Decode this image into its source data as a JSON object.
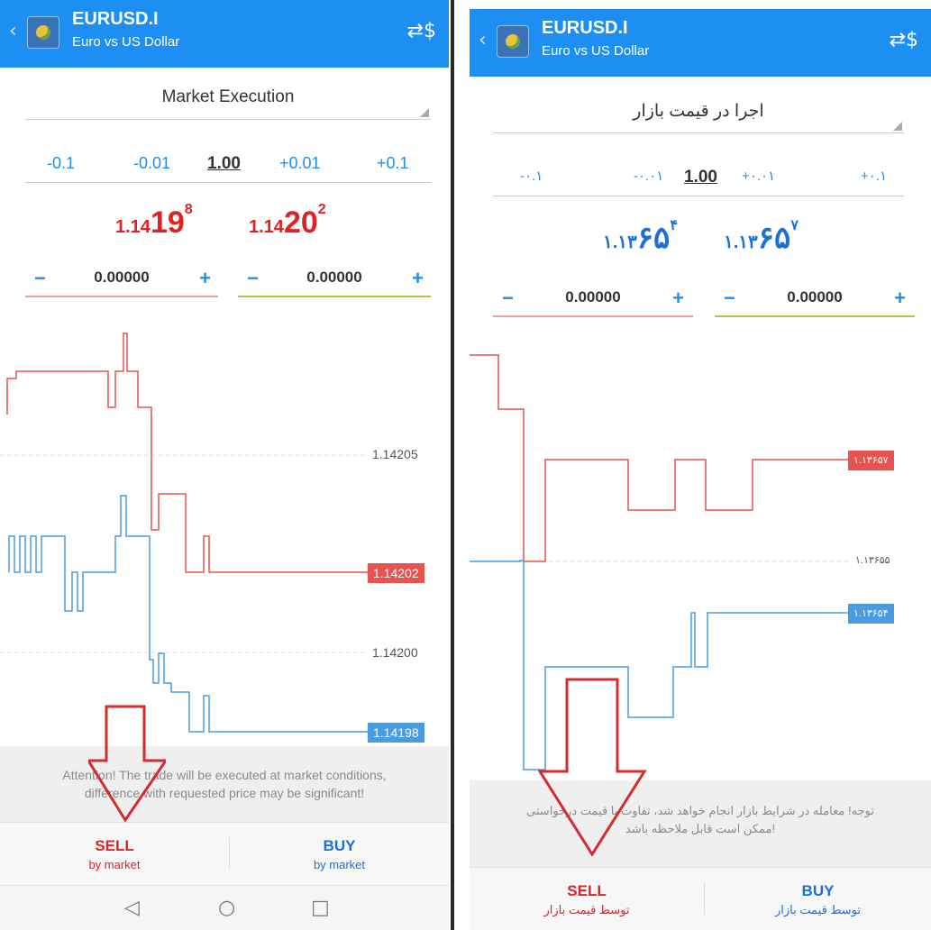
{
  "left": {
    "symbol": "EURUSD.I",
    "description": "Euro vs US Dollar",
    "back_icon": "chevron-left-icon",
    "swap_icon": "currency-exchange-icon",
    "execution_type": "Market Execution",
    "volume": {
      "minus_01": "-0.1",
      "minus_001": "-0.01",
      "value": "1.00",
      "plus_001": "+0.01",
      "plus_01": "+0.1"
    },
    "sell_price": {
      "prefix": "1.14",
      "big": "19",
      "sup": "8"
    },
    "buy_price": {
      "prefix": "1.14",
      "big": "20",
      "sup": "2"
    },
    "stop_loss": {
      "minus": "−",
      "value": "0.00000",
      "plus": "+"
    },
    "take_profit": {
      "minus": "−",
      "value": "0.00000",
      "plus": "+"
    },
    "levels": {
      "upper": "1.14205",
      "mid": "1.14200"
    },
    "tags": {
      "ask": "1.14202",
      "bid": "1.14198"
    },
    "warning_line1": "Attention! The trade will be executed at market conditions,",
    "warning_line2": "difference with requested price may be significant!",
    "sell_label": "SELL",
    "sell_sub": "by market",
    "buy_label": "BUY",
    "buy_sub": "by market",
    "nav": {
      "back": "◁",
      "home": "○",
      "recent": "□"
    }
  },
  "right": {
    "symbol": "EURUSD.I",
    "description": "Euro vs US Dollar",
    "execution_type": "اجرا در قیمت بازار",
    "volume": {
      "minus_01": "-۰.۱",
      "minus_001": "-۰.۰۱",
      "value": "1.00",
      "plus_001": "+۰.۰۱",
      "plus_01": "+۰.۱"
    },
    "sell_price": {
      "prefix": "۱.۱۳",
      "big": "۶۵",
      "sup": "۴"
    },
    "buy_price": {
      "prefix": "۱.۱۳",
      "big": "۶۵",
      "sup": "۷"
    },
    "stop_loss": {
      "minus": "−",
      "value": "0.00000",
      "plus": "+"
    },
    "take_profit": {
      "minus": "−",
      "value": "0.00000",
      "plus": "+"
    },
    "levels": {
      "mid": "۱.۱۳۶۵۵"
    },
    "tags": {
      "ask": "۱.۱۳۶۵۷",
      "bid": "۱.۱۳۶۵۴"
    },
    "warning_line1": "توجه! معامله در شرایط بازار انجام خواهد شد، تفاوت با قیمت درخواستی",
    "warning_line2": "ممکن است قابل ملاحظه باشد!",
    "sell_label": "SELL",
    "sell_sub": "توسط قیمت بازار",
    "buy_label": "BUY",
    "buy_sub": "توسط قیمت بازار"
  },
  "colors": {
    "appbar": "#1d8ff2",
    "sell": "#e02222",
    "buy": "#1d6fd8",
    "ask_line": "#e8534f",
    "bid_line": "#4a9be0",
    "arrow": "#d62b2b"
  }
}
